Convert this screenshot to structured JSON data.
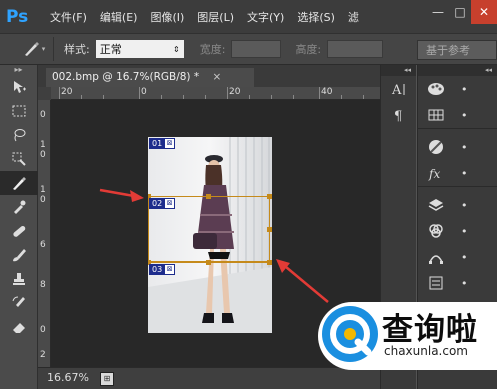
{
  "app": {
    "logo": "Ps",
    "brand_color": "#2fa3ff"
  },
  "menu": [
    "文件(F)",
    "编辑(E)",
    "图像(I)",
    "图层(L)",
    "文字(Y)",
    "选择(S)",
    "滤"
  ],
  "window_controls": {
    "minimize": "—",
    "restore": "□",
    "close": "✕"
  },
  "options_bar": {
    "tool_icon": "slice-tool-icon",
    "style_label": "样式:",
    "style_value": "正常",
    "width_label": "宽度:",
    "height_label": "高度:",
    "slices_button": "基于参考"
  },
  "document": {
    "tab_title": "002.bmp @ 16.7%(RGB/8) *",
    "tab_close": "×",
    "ruler_top": [
      "20",
      "0",
      "20",
      "40"
    ],
    "ruler_left": [
      "0",
      "1\n0",
      "1\n0",
      "6",
      "8",
      "0",
      "2"
    ],
    "slices": [
      {
        "num": "01",
        "icon": "⊠"
      },
      {
        "num": "02",
        "icon": "⊠"
      },
      {
        "num": "03",
        "icon": "⊠"
      }
    ],
    "arrow_color": "#e23b36",
    "selection_color": "#c58a1b"
  },
  "status": {
    "zoom": "16.67%"
  },
  "right_panel_col1": [
    "character-icon",
    "paragraph-icon"
  ],
  "right_panel_col2": [
    {
      "icon": "color-palette-icon",
      "dots": "•"
    },
    {
      "icon": "swatches-icon",
      "dots": "•"
    },
    {
      "icon": "adjustments-icon",
      "dots": "•"
    },
    {
      "icon": "fx-styles-icon",
      "dots": "•"
    },
    {
      "icon": "layers-icon",
      "dots": "•"
    },
    {
      "icon": "channels-icon",
      "dots": "•"
    },
    {
      "icon": "paths-icon",
      "dots": "•"
    },
    {
      "icon": "history-icon",
      "dots": "•"
    }
  ],
  "watermark": {
    "text": "查询啦",
    "sub": "chaxunla.com"
  }
}
